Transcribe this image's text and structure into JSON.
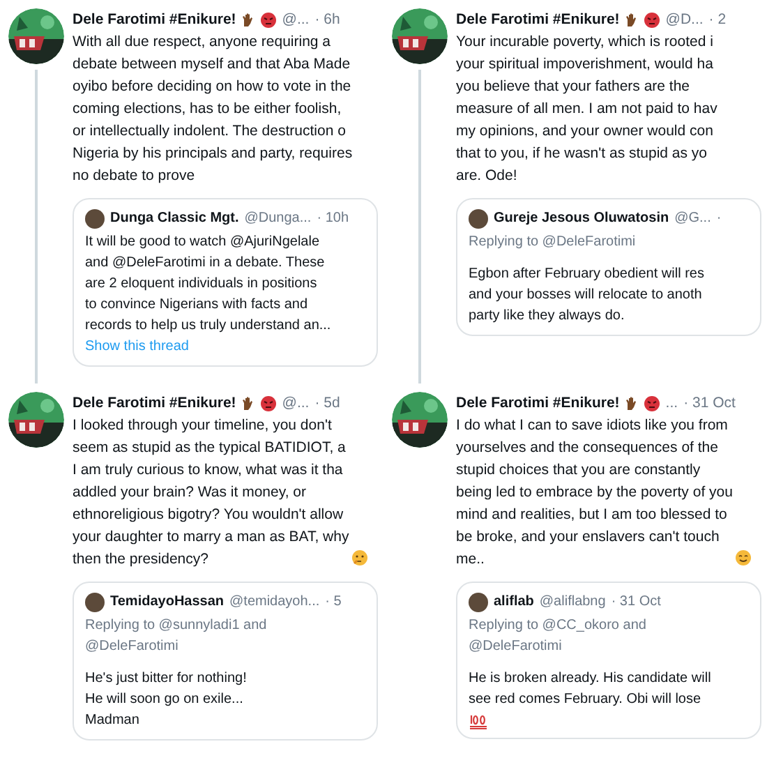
{
  "panels": [
    {
      "author": {
        "name": "Dele Farotimi #Enikure!",
        "handle": "@...",
        "time": "· 6h"
      },
      "thread_line": true,
      "body": "With all due respect, anyone requiring a\ndebate between myself and that Aba Made\noyibo before deciding on how to vote in the\ncoming elections, has to be either foolish,\nor intellectually indolent. The destruction o\nNigeria by his principals and party, requires\nno debate to prove",
      "quote": {
        "name": "Dunga Classic Mgt.",
        "handle": "@Dunga...",
        "time": "· 10h",
        "body": "It will be good to watch @AjuriNgelale\nand @DeleFarotimi in a debate. These\nare 2 eloquent individuals in positions\nto convince Nigerians with facts and\nrecords to help us truly understand an...",
        "link": "Show this thread"
      }
    },
    {
      "author": {
        "name": "Dele Farotimi #Enikure!",
        "handle": "@D...",
        "time": "· 2"
      },
      "thread_line": true,
      "body": "Your incurable poverty, which is rooted i\nyour spiritual impoverishment, would ha\nyou believe that your fathers are the\nmeasure of all men. I am not paid to hav\nmy opinions, and your owner would con\nthat to you, if he wasn't as stupid as yo\nare. Ode!",
      "quote": {
        "name": "Gureje Jesous Oluwatosin",
        "handle": "@G...",
        "time": "·",
        "replying": "Replying to @DeleFarotimi",
        "body": "Egbon after February obedient will res\nand your bosses will relocate to anoth\nparty like they always do."
      }
    },
    {
      "author": {
        "name": "Dele Farotimi #Enikure!",
        "handle": "@...",
        "time": "· 5d"
      },
      "thread_line": false,
      "body": "I looked through your timeline, you don't\nseem as stupid as the typical BATIDIOT, a\nI am truly curious to know, what was it tha\naddled your brain? Was it money, or\nethnoreligious bigotry? You wouldn't allow\nyour daughter to marry a man as BAT, why\nthen the presidency?",
      "end_icon": {
        "kind": "thinking"
      },
      "quote": {
        "name": "TemidayoHassan",
        "handle": "@temidayoh...",
        "time": "· 5",
        "replying": "Replying to @sunnyladi1 and\n@DeleFarotimi",
        "body": "He's just bitter for nothing!\nHe will soon go on exile...\nMadman"
      }
    },
    {
      "author": {
        "name": "Dele Farotimi #Enikure!",
        "handle": "...",
        "time": "· 31 Oct"
      },
      "thread_line": false,
      "body": "I do what I can to save idiots like you from\nyourselves and the consequences of the\nstupid choices that you are constantly\nbeing led to embrace by the poverty of you\nmind and realities, but I am too blessed to\nbe broke, and your enslavers can't touch\nme..",
      "end_icon": {
        "kind": "smile"
      },
      "quote": {
        "name": "aliflab",
        "handle": "@aliflabng",
        "time": "· 31 Oct",
        "replying": "Replying to @CC_okoro and\n@DeleFarotimi",
        "body": "He is broken already. His candidate will\nsee red comes February. Obi will lose",
        "end_icon": {
          "kind": "hundred"
        }
      }
    }
  ]
}
